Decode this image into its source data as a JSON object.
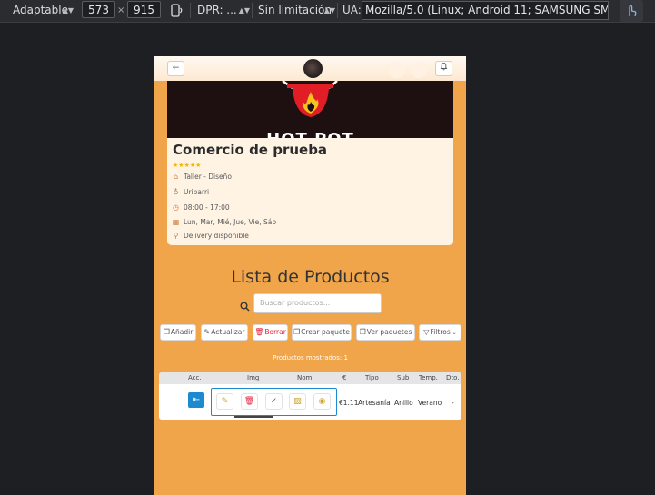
{
  "devtools": {
    "device_mode": "Adaptable",
    "width": "573",
    "times": "×",
    "height": "915",
    "dpr": "DPR: ...",
    "throttle": "Sin limitación",
    "ua_label": "UA:",
    "ua_value": "Mozilla/5.0 (Linux; Android 11; SAMSUNG SM-G97"
  },
  "header": {
    "back_icon": "arrow-left-icon",
    "bell_icon": "bell-icon"
  },
  "business": {
    "logo_text": "HOT POT",
    "name": "Comercio de prueba",
    "rating": "★★★★★",
    "category": "Taller - Diseño",
    "location": "Uribarri",
    "hours": "08:00 - 17:00",
    "days": "Lun, Mar, Mié, Jue, Vie, Sáb",
    "delivery": "Delivery disponible"
  },
  "products": {
    "title": "Lista de Productos",
    "search_placeholder": "Buscar productos...",
    "buttons": {
      "add": "Añadir",
      "refresh": "Actualizar",
      "delete": "Borrar",
      "create_pack": "Crear paquete",
      "view_packs": "Ver paquetes",
      "filters": "Filtros"
    },
    "shown_count": "Productos mostrados: 1",
    "columns": [
      "Acc.",
      "Img",
      "Nom.",
      "€",
      "Tipo",
      "Sub",
      "Temp.",
      "Dto."
    ],
    "rows": [
      {
        "price": "€1.11",
        "type": "Artesanía",
        "sub": "Anillo",
        "season": "Verano",
        "discount": "-"
      }
    ]
  },
  "colors": {
    "page_bg": "#f0a54a",
    "accent_blue": "#1b8ad1",
    "danger": "#e2233b",
    "star": "#f5b400"
  }
}
